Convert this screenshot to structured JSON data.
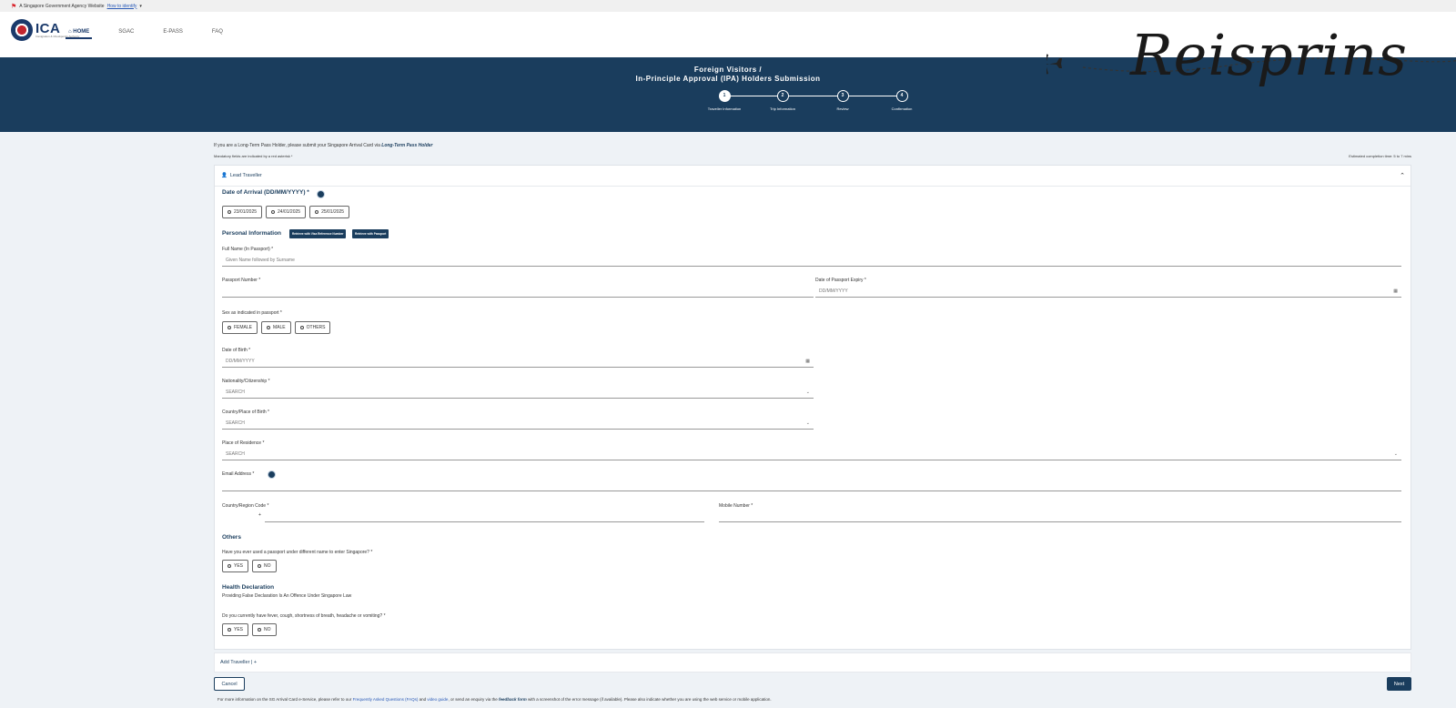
{
  "gov_bar": {
    "text": "A Singapore Government Agency Website",
    "link": "How to identify"
  },
  "logo": {
    "name": "ICA",
    "subtitle": "Immigration & Checkpoints Authority"
  },
  "nav": {
    "items": [
      "HOME",
      "SGAC",
      "E-PASS",
      "FAQ"
    ],
    "active_index": 0
  },
  "watermark": {
    "text": "Reisprins"
  },
  "banner": {
    "title_line1": "Foreign Visitors /",
    "title_line2": "In-Principle Approval (IPA) Holders Submission",
    "steps": [
      {
        "number": "1",
        "label": "Traveller Information"
      },
      {
        "number": "2",
        "label": "Trip Information"
      },
      {
        "number": "3",
        "label": "Review"
      },
      {
        "number": "4",
        "label": "Confirmation"
      }
    ],
    "active_step": 1
  },
  "notice": {
    "text": "If you are a Long-Term Pass Holder, please submit your Singapore Arrival Card via",
    "link": "Long-Term Pass Holder"
  },
  "mandatory_note": "Mandatory fields are indicated by a red asterisk *",
  "estimate": "Estimated completion time: 5 to 7 mins",
  "card": {
    "header": "Lead Traveller",
    "arrival": {
      "title": "Date of Arrival (DD/MM/YYYY) *",
      "options": [
        "23/01/2025",
        "24/01/2025",
        "25/01/2025"
      ]
    },
    "personal": {
      "title": "Personal Information",
      "btn_reference": "Retrieve with Visa Reference Number",
      "btn_passport": "Retrieve with Passport"
    },
    "full_name": {
      "label": "Full Name (In Passport) *",
      "placeholder": "Given Name followed by Surname"
    },
    "passport_number": {
      "label": "Passport Number *"
    },
    "passport_expiry": {
      "label": "Date of Passport Expiry *",
      "placeholder": "DD/MM/YYYY"
    },
    "sex": {
      "label": "Sex as indicated in passport *",
      "options": [
        "FEMALE",
        "MALE",
        "OTHERS"
      ]
    },
    "dob": {
      "label": "Date of Birth *",
      "placeholder": "DD/MM/YYYY"
    },
    "nationality": {
      "label": "Nationality/Citizenship *",
      "placeholder": "SEARCH"
    },
    "birth_place": {
      "label": "Country/Place of Birth *",
      "placeholder": "SEARCH"
    },
    "residence": {
      "label": "Place of Residence *",
      "placeholder": "SEARCH"
    },
    "email": {
      "label": "Email Address *"
    },
    "region_code": {
      "label": "Country/Region Code *",
      "prefix": "+"
    },
    "mobile": {
      "label": "Mobile Number *"
    },
    "others": {
      "title": "Others",
      "question": "Have you ever used a passport under different name to enter Singapore? *",
      "options": [
        "YES",
        "NO"
      ]
    },
    "health": {
      "title": "Health Declaration",
      "subtitle": "Providing False Declaration Is An Offence Under Singapore Law",
      "question": "Do you currently have fever, cough, shortness of breath, headache or vomiting? *",
      "options": [
        "YES",
        "NO"
      ]
    }
  },
  "add_traveller": "Add Traveller | +",
  "buttons": {
    "cancel": "Cancel",
    "next": "Next"
  },
  "footer": {
    "t1": "For more information on the SG Arrival Card e-Service, please refer to our",
    "faq": "Frequently Asked Questions (FAQs)",
    "t2": "and",
    "video": "video guide",
    "t3": ", or send an enquiry via the",
    "feedback": "feedback form",
    "t4": "with a screenshot of the error message (if available). Please also indicate whether you are using the web service or mobile application."
  }
}
